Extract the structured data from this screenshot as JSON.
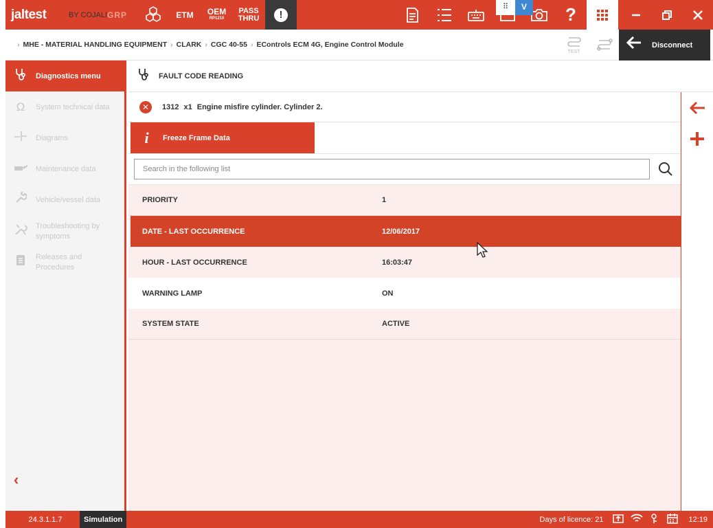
{
  "topbar": {
    "logo": "jaltest",
    "logo_sub": "BY COJALI",
    "grp": "GRP",
    "etm": "ETM",
    "oem": "OEM",
    "oem_sub": "RP1210",
    "pass_line1": "PASS",
    "pass_line2": "THRU",
    "alert": "!",
    "icons": [
      "report-icon",
      "list-icon",
      "keyboard-icon",
      "monitor-icon",
      "camera-icon",
      "help-icon",
      "apps-grid-icon"
    ],
    "help": "?",
    "overlay_grid": "⠿",
    "overlay_check": "V"
  },
  "breadcrumb": {
    "items": [
      "MHE - MATERIAL HANDLING EQUIPMENT",
      "CLARK",
      "CGC 40-55",
      "EControls ECM 4G, Engine Control Module"
    ],
    "test_label": "TEST",
    "disconnect_label": "Disconnect"
  },
  "sidebar": {
    "active": "Diagnostics menu",
    "items": [
      "System technical data",
      "Diagrams",
      "Maintenance data",
      "Vehicle/vessel data",
      "Troubleshooting by symptoms",
      "Releases and Procedures"
    ]
  },
  "main": {
    "title": "FAULT CODE READING",
    "fault": {
      "code": "1312",
      "count": "x1",
      "description": "Engine misfire cylinder. Cylinder 2."
    },
    "tab_label": "Freeze Frame Data",
    "search_placeholder": "Search in the following list",
    "rows": [
      {
        "key": "PRIORITY",
        "value": "1"
      },
      {
        "key": "DATE - LAST OCCURRENCE",
        "value": "12/06/2017"
      },
      {
        "key": "HOUR - LAST OCCURRENCE",
        "value": "16:03:47"
      },
      {
        "key": "WARNING LAMP",
        "value": "ON"
      },
      {
        "key": "SYSTEM STATE",
        "value": "ACTIVE"
      }
    ]
  },
  "status": {
    "version": "24.3.1.1.7",
    "mode": "Simulation",
    "licence": "Days of licence: 21",
    "time": "12:19"
  },
  "colors": {
    "accent": "#d9412a",
    "dark": "#2e2e2e",
    "row_tint": "#fbeeec",
    "sidebar_bg": "#f4f4f4"
  }
}
